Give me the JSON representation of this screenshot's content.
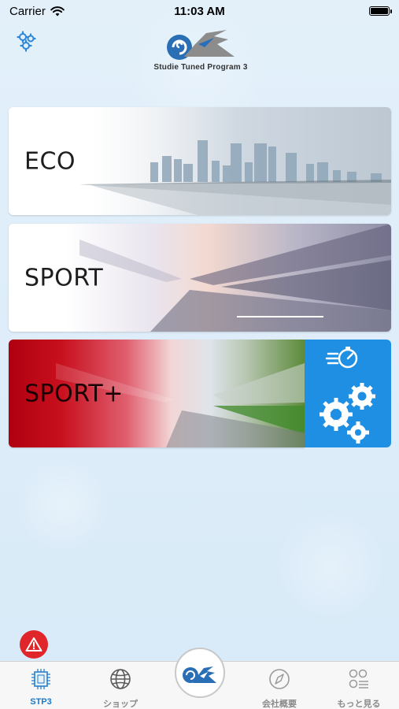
{
  "status_bar": {
    "carrier": "Carrier",
    "time": "11:03 AM"
  },
  "header": {
    "logo_text": "Studie Tuned Program 3",
    "settings_icon": "gears-icon"
  },
  "modes": [
    {
      "label": "ECO",
      "icon": "city-skyline-image"
    },
    {
      "label": "SPORT",
      "icon": "race-track-image"
    },
    {
      "label": "SPORT+",
      "icon": "race-track-image"
    }
  ],
  "custom_panel": {
    "icon": "stopwatch-gears-icon"
  },
  "alert": {
    "icon": "warning-icon"
  },
  "tab_bar": {
    "tabs": [
      {
        "label": "STP3",
        "icon": "chip-icon",
        "active": true
      },
      {
        "label": "ショップ",
        "icon": "globe-icon",
        "active": false
      },
      {
        "label": "会社概要",
        "icon": "compass-icon",
        "active": false
      },
      {
        "label": "もっと見る",
        "icon": "more-grid-icon",
        "active": false
      }
    ],
    "center_icon": "studie-logo-icon"
  },
  "colors": {
    "accent": "#1e78c8",
    "panel_blue": "#1e8fe3",
    "alert_red": "#e0262a",
    "sport_plus_red": "#b00010"
  }
}
